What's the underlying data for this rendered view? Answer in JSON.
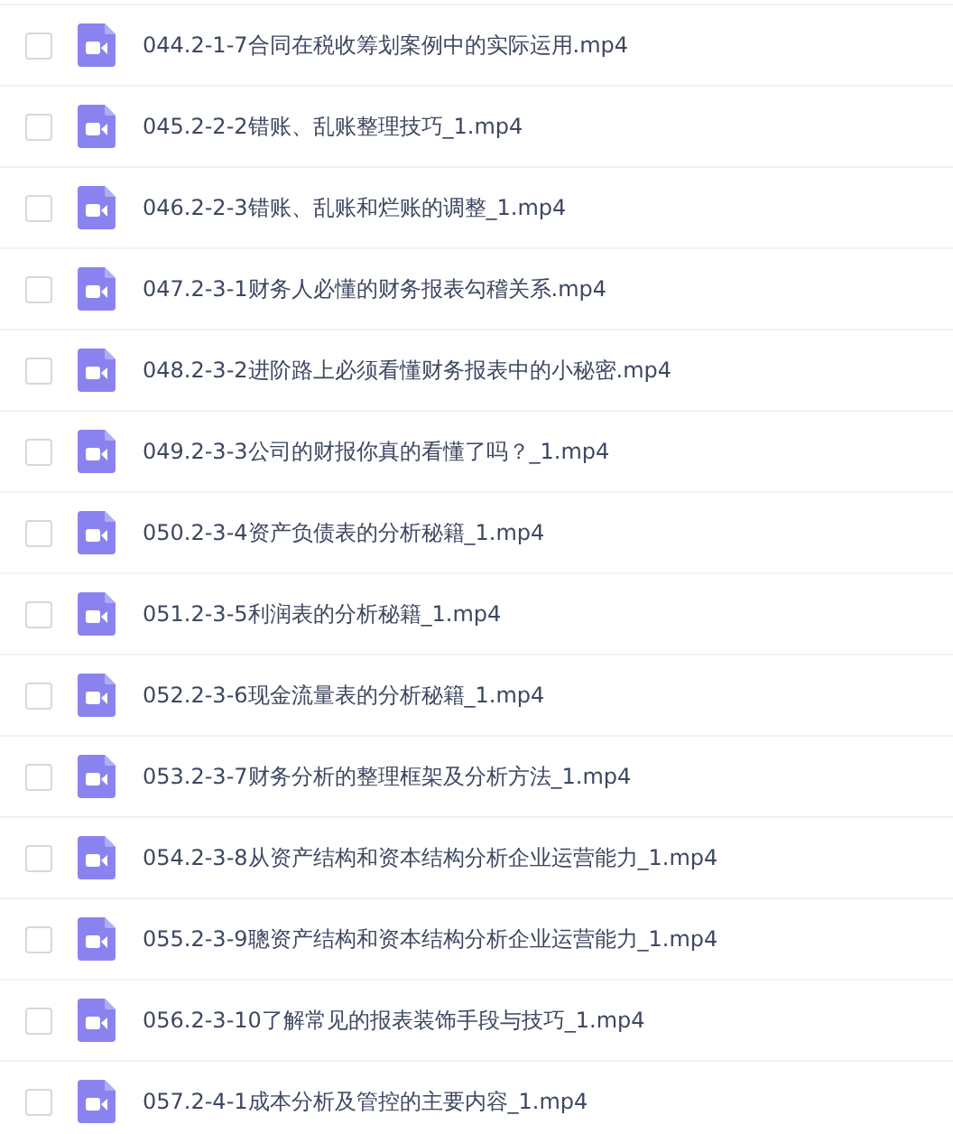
{
  "files": [
    {
      "name": "044.2-1-7合同在税收筹划案例中的实际运用.mp4",
      "checked": false
    },
    {
      "name": "045.2-2-2错账、乱账整理技巧_1.mp4",
      "checked": false
    },
    {
      "name": "046.2-2-3错账、乱账和烂账的调整_1.mp4",
      "checked": false
    },
    {
      "name": "047.2-3-1财务人必懂的财务报表勾稽关系.mp4",
      "checked": false
    },
    {
      "name": "048.2-3-2进阶路上必须看懂财务报表中的小秘密.mp4",
      "checked": false
    },
    {
      "name": "049.2-3-3公司的财报你真的看懂了吗？_1.mp4",
      "checked": false
    },
    {
      "name": "050.2-3-4资产负债表的分析秘籍_1.mp4",
      "checked": false
    },
    {
      "name": "051.2-3-5利润表的分析秘籍_1.mp4",
      "checked": false
    },
    {
      "name": "052.2-3-6现金流量表的分析秘籍_1.mp4",
      "checked": false
    },
    {
      "name": "053.2-3-7财务分析的整理框架及分析方法_1.mp4",
      "checked": false
    },
    {
      "name": "054.2-3-8从资产结构和资本结构分析企业运营能力_1.mp4",
      "checked": false
    },
    {
      "name": "055.2-3-9聰资产结构和资本结构分析企业运营能力_1.mp4",
      "checked": false
    },
    {
      "name": "056.2-3-10了解常见的报表装饰手段与技巧_1.mp4",
      "checked": false
    },
    {
      "name": "057.2-4-1成本分析及管控的主要内容_1.mp4",
      "checked": false
    }
  ]
}
